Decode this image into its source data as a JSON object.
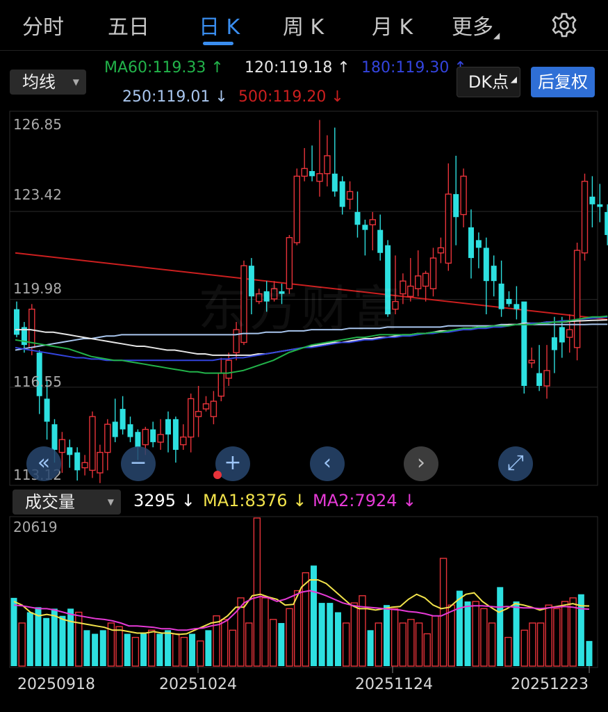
{
  "tabs": [
    {
      "label": "分时",
      "active": false
    },
    {
      "label": "五日",
      "active": false
    },
    {
      "label": "日 K",
      "active": true
    },
    {
      "label": "周 K",
      "active": false
    },
    {
      "label": "月 K",
      "active": false
    },
    {
      "label": "更多",
      "active": false
    }
  ],
  "more_caret": "◢",
  "settings_icon": "gear-icon",
  "indicator_select": {
    "label": "均线",
    "caret": "▼"
  },
  "ma_values": {
    "ma60": "MA60:119.33 ↑",
    "ma120": "120:119.18 ↑",
    "ma180": "180:119.30 ↑",
    "ma250": "250:119.01 ↓",
    "ma500": "500:119.20 ↓"
  },
  "dk_button": {
    "label": "DK点",
    "caret": "◢"
  },
  "adjust_button": "后复权",
  "watermark": "东方财富",
  "controls": {
    "back": "«",
    "zoom_out": "−",
    "zoom_in": "+",
    "prev": "‹",
    "next": "›",
    "fullscreen": "⤢"
  },
  "volume": {
    "select_label": "成交量",
    "caret": "▼",
    "current": "3295 ↓",
    "ma1": "MA1:8376 ↓",
    "ma2": "MA2:7924 ↓",
    "max_label": "20619"
  },
  "dates": [
    "20250918",
    "20251024",
    "20251124",
    "20251223"
  ],
  "colors": {
    "up": "#e8333a",
    "down": "#2de0e0",
    "ma60": "#22b34a",
    "ma120": "#e6e6e6",
    "ma180": "#3344dd",
    "ma250": "#a9c6ee",
    "ma500": "#cc1f1f",
    "vma1": "#f2e34b",
    "vma2": "#e63ad6",
    "accent": "#3a8ef0"
  },
  "chart_data": {
    "type": "candlestick",
    "price_ticks": [
      "126.85",
      "123.42",
      "119.98",
      "116.55",
      "113.12"
    ],
    "ylim": [
      113.12,
      126.85
    ],
    "candles": [
      [
        119.6,
        118.6,
        119.9,
        118.5
      ],
      [
        118.9,
        118.2,
        119.1,
        117.9
      ],
      [
        118.1,
        119.6,
        119.8,
        117.8
      ],
      [
        117.9,
        116.2,
        118.0,
        115.5
      ],
      [
        116.1,
        115.2,
        116.8,
        114.5
      ],
      [
        115.1,
        114.1,
        115.3,
        113.6
      ],
      [
        114.0,
        114.5,
        114.8,
        113.2
      ],
      [
        114.2,
        113.9,
        114.5,
        113.4
      ],
      [
        114.0,
        113.3,
        114.2,
        112.9
      ],
      [
        113.4,
        113.6,
        113.9,
        113.1
      ],
      [
        113.3,
        115.4,
        115.6,
        113.0
      ],
      [
        113.2,
        114.0,
        114.3,
        112.8
      ],
      [
        114.0,
        115.1,
        115.3,
        113.3
      ],
      [
        115.2,
        114.6,
        116.1,
        114.4
      ],
      [
        115.7,
        114.9,
        116.2,
        114.7
      ],
      [
        115.1,
        114.6,
        115.4,
        114.4
      ],
      [
        114.8,
        114.2,
        114.9,
        113.7
      ],
      [
        114.3,
        114.9,
        115.0,
        113.9
      ],
      [
        114.9,
        114.4,
        115.2,
        114.2
      ],
      [
        114.4,
        114.7,
        115.3,
        114.1
      ],
      [
        115.3,
        114.7,
        115.6,
        114.0
      ],
      [
        115.3,
        114.1,
        115.4,
        113.6
      ],
      [
        114.3,
        114.6,
        115.1,
        114.1
      ],
      [
        114.6,
        116.1,
        116.3,
        114.0
      ],
      [
        115.4,
        115.6,
        116.6,
        114.6
      ],
      [
        115.7,
        115.9,
        116.2,
        115.6
      ],
      [
        115.4,
        116.0,
        116.4,
        115.1
      ],
      [
        116.2,
        117.1,
        117.7,
        116.0
      ],
      [
        116.9,
        117.6,
        117.9,
        116.6
      ],
      [
        117.9,
        118.8,
        119.1,
        117.6
      ],
      [
        118.3,
        121.3,
        121.5,
        118.2
      ],
      [
        121.3,
        120.1,
        121.6,
        119.4
      ],
      [
        119.9,
        120.2,
        120.4,
        119.8
      ],
      [
        120.3,
        119.9,
        120.7,
        119.5
      ],
      [
        120.0,
        120.4,
        120.7,
        119.9
      ],
      [
        120.3,
        120.2,
        120.6,
        119.8
      ],
      [
        120.4,
        122.4,
        122.5,
        120.2
      ],
      [
        122.2,
        124.8,
        125.1,
        122.1
      ],
      [
        124.8,
        125.1,
        125.9,
        124.6
      ],
      [
        125.0,
        124.8,
        126.0,
        124.6
      ],
      [
        124.6,
        124.9,
        127.0,
        124.0
      ],
      [
        124.9,
        125.6,
        126.4,
        124.4
      ],
      [
        124.9,
        124.2,
        126.7,
        124.0
      ],
      [
        124.6,
        123.6,
        124.8,
        123.3
      ],
      [
        123.9,
        124.2,
        124.6,
        123.5
      ],
      [
        123.4,
        122.9,
        124.2,
        122.4
      ],
      [
        122.9,
        122.7,
        123.1,
        121.7
      ],
      [
        122.9,
        123.1,
        123.4,
        121.9
      ],
      [
        122.7,
        121.8,
        123.3,
        121.5
      ],
      [
        122.1,
        119.4,
        122.3,
        119.3
      ],
      [
        119.6,
        119.9,
        121.7,
        119.4
      ],
      [
        120.2,
        120.7,
        121.0,
        119.8
      ],
      [
        120.1,
        120.5,
        121.6,
        119.9
      ],
      [
        120.4,
        120.9,
        121.9,
        120.1
      ],
      [
        120.5,
        121.0,
        121.1,
        119.9
      ],
      [
        120.4,
        121.6,
        122.0,
        120.1
      ],
      [
        121.8,
        122.0,
        122.4,
        121.4
      ],
      [
        121.4,
        124.1,
        125.3,
        121.1
      ],
      [
        124.1,
        123.2,
        125.6,
        122.1
      ],
      [
        123.3,
        124.8,
        125.1,
        122.8
      ],
      [
        122.8,
        121.6,
        123.5,
        120.8
      ],
      [
        122.3,
        122.0,
        122.6,
        121.2
      ],
      [
        122.0,
        120.7,
        122.4,
        119.4
      ],
      [
        121.3,
        120.7,
        121.7,
        120.1
      ],
      [
        120.6,
        119.6,
        121.5,
        119.3
      ],
      [
        120.0,
        119.8,
        120.3,
        119.7
      ],
      [
        119.8,
        119.6,
        120.5,
        119.2
      ],
      [
        119.9,
        116.6,
        119.8,
        116.3
      ],
      [
        117.5,
        117.6,
        118.1,
        117.3
      ],
      [
        117.1,
        116.6,
        118.2,
        116.4
      ],
      [
        116.6,
        117.2,
        118.2,
        116.1
      ],
      [
        118.5,
        118.0,
        119.3,
        117.1
      ],
      [
        118.9,
        118.3,
        119.3,
        117.7
      ],
      [
        118.5,
        118.8,
        119.4,
        117.9
      ],
      [
        118.1,
        121.9,
        122.2,
        117.6
      ],
      [
        121.8,
        124.6,
        124.9,
        121.5
      ],
      [
        124.0,
        123.7,
        124.8,
        122.8
      ],
      [
        123.7,
        123.6,
        124.5,
        123.0
      ],
      [
        123.4,
        122.5,
        123.7,
        122.1
      ]
    ],
    "ma60": [
      118.4,
      118.35,
      118.3,
      118.25,
      118.2,
      118.15,
      118.1,
      118.05,
      117.95,
      117.85,
      117.75,
      117.7,
      117.65,
      117.6,
      117.6,
      117.55,
      117.5,
      117.45,
      117.4,
      117.35,
      117.3,
      117.25,
      117.2,
      117.15,
      117.15,
      117.1,
      117.1,
      117.1,
      117.1,
      117.15,
      117.2,
      117.3,
      117.4,
      117.5,
      117.6,
      117.75,
      117.9,
      118.0,
      118.1,
      118.2,
      118.25,
      118.3,
      118.35,
      118.4,
      118.45,
      118.5,
      118.5,
      118.55,
      118.6,
      118.6,
      118.6,
      118.6,
      118.6,
      118.65,
      118.65,
      118.7,
      118.7,
      118.75,
      118.8,
      118.85,
      118.85,
      118.9,
      118.9,
      118.95,
      118.95,
      118.95,
      119.0,
      119.0,
      119.0,
      119.05,
      119.05,
      119.1,
      119.1,
      119.15,
      119.2,
      119.25,
      119.3,
      119.3,
      119.33
    ],
    "ma120": [
      118.8,
      118.8,
      118.8,
      118.75,
      118.7,
      118.7,
      118.65,
      118.6,
      118.55,
      118.5,
      118.45,
      118.4,
      118.35,
      118.3,
      118.25,
      118.2,
      118.15,
      118.15,
      118.1,
      118.05,
      118.0,
      118.0,
      117.95,
      117.9,
      117.85,
      117.85,
      117.8,
      117.8,
      117.8,
      117.8,
      117.8,
      117.8,
      117.85,
      117.85,
      117.9,
      117.95,
      118.0,
      118.05,
      118.1,
      118.15,
      118.2,
      118.25,
      118.3,
      118.3,
      118.35,
      118.4,
      118.45,
      118.45,
      118.5,
      118.5,
      118.55,
      118.6,
      118.6,
      118.65,
      118.65,
      118.7,
      118.75,
      118.75,
      118.8,
      118.85,
      118.85,
      118.9,
      118.9,
      118.95,
      118.95,
      119.0,
      119.0,
      119.05,
      119.05,
      119.05,
      119.1,
      119.1,
      119.1,
      119.12,
      119.14,
      119.15,
      119.16,
      119.17,
      119.18
    ],
    "ma180": [
      118.1,
      118.05,
      118.0,
      117.95,
      117.9,
      117.85,
      117.8,
      117.75,
      117.7,
      117.7,
      117.65,
      117.65,
      117.6,
      117.6,
      117.6,
      117.6,
      117.6,
      117.6,
      117.6,
      117.6,
      117.6,
      117.6,
      117.6,
      117.6,
      117.6,
      117.6,
      117.6,
      117.65,
      117.65,
      117.7,
      117.7,
      117.75,
      117.8,
      117.85,
      117.9,
      117.95,
      118.0,
      118.05,
      118.1,
      118.1,
      118.15,
      118.2,
      118.25,
      118.3,
      118.3,
      118.35,
      118.4,
      118.4,
      118.45,
      118.5,
      118.5,
      118.55,
      118.55,
      118.6,
      118.65,
      118.65,
      118.7,
      118.7,
      118.75,
      118.8,
      118.8,
      118.85,
      118.85,
      118.9,
      118.9,
      118.95,
      119.0,
      119.0,
      119.05,
      119.05,
      119.1,
      119.1,
      119.15,
      119.15,
      119.2,
      119.22,
      119.25,
      119.27,
      119.3
    ],
    "ma250": [
      118.0,
      118.05,
      118.1,
      118.15,
      118.2,
      118.25,
      118.3,
      118.35,
      118.4,
      118.45,
      118.45,
      118.5,
      118.55,
      118.55,
      118.6,
      118.6,
      118.6,
      118.6,
      118.6,
      118.6,
      118.6,
      118.6,
      118.6,
      118.6,
      118.6,
      118.6,
      118.6,
      118.6,
      118.6,
      118.6,
      118.65,
      118.65,
      118.65,
      118.7,
      118.7,
      118.7,
      118.75,
      118.75,
      118.75,
      118.8,
      118.8,
      118.8,
      118.8,
      118.8,
      118.85,
      118.85,
      118.85,
      118.85,
      118.85,
      118.9,
      118.9,
      118.9,
      118.9,
      118.9,
      118.9,
      118.9,
      118.9,
      118.95,
      118.95,
      118.95,
      118.95,
      118.95,
      118.95,
      118.95,
      119.0,
      119.0,
      119.0,
      119.0,
      119.0,
      119.0,
      119.0,
      119.0,
      119.0,
      119.0,
      119.0,
      119.0,
      119.01,
      119.01,
      119.01
    ],
    "ma500": {
      "start": 121.8,
      "end": 119.2
    },
    "volume": {
      "ylim": [
        0,
        20619
      ],
      "bars": [
        [
          9500,
          0
        ],
        [
          6000,
          1
        ],
        [
          7500,
          0
        ],
        [
          8200,
          0
        ],
        [
          6700,
          0
        ],
        [
          8000,
          0
        ],
        [
          7000,
          0
        ],
        [
          8000,
          0
        ],
        [
          7500,
          1
        ],
        [
          5000,
          0
        ],
        [
          4500,
          0
        ],
        [
          5000,
          0
        ],
        [
          6000,
          1
        ],
        [
          5500,
          1
        ],
        [
          4500,
          0
        ],
        [
          4000,
          1
        ],
        [
          4500,
          0
        ],
        [
          5000,
          1
        ],
        [
          4500,
          0
        ],
        [
          5000,
          0
        ],
        [
          4500,
          1
        ],
        [
          4000,
          1
        ],
        [
          4500,
          0
        ],
        [
          3500,
          1
        ],
        [
          5000,
          0
        ],
        [
          7000,
          1
        ],
        [
          6500,
          1
        ],
        [
          5000,
          1
        ],
        [
          9500,
          1
        ],
        [
          6000,
          1
        ],
        [
          20619,
          1
        ],
        [
          9500,
          1
        ],
        [
          6500,
          1
        ],
        [
          6000,
          0
        ],
        [
          8000,
          1
        ],
        [
          10500,
          1
        ],
        [
          13000,
          1
        ],
        [
          14000,
          0
        ],
        [
          8800,
          0
        ],
        [
          8800,
          0
        ],
        [
          7500,
          0
        ],
        [
          6000,
          1
        ],
        [
          8800,
          1
        ],
        [
          9800,
          1
        ],
        [
          5000,
          0
        ],
        [
          6000,
          1
        ],
        [
          8500,
          0
        ],
        [
          8000,
          1
        ],
        [
          6000,
          1
        ],
        [
          6500,
          1
        ],
        [
          6000,
          1
        ],
        [
          4500,
          1
        ],
        [
          7000,
          1
        ],
        [
          15000,
          1
        ],
        [
          8500,
          1
        ],
        [
          10500,
          0
        ],
        [
          9000,
          0
        ],
        [
          9000,
          1
        ],
        [
          8000,
          1
        ],
        [
          6000,
          1
        ],
        [
          11000,
          0
        ],
        [
          4000,
          1
        ],
        [
          9000,
          0
        ],
        [
          5000,
          1
        ],
        [
          6000,
          1
        ],
        [
          6000,
          1
        ],
        [
          8500,
          1
        ],
        [
          8000,
          1
        ],
        [
          9000,
          1
        ],
        [
          9500,
          1
        ],
        [
          10000,
          0
        ],
        [
          3500,
          0
        ]
      ],
      "ma1": [
        9000,
        8500,
        7500,
        7000,
        7200,
        7000,
        6500,
        6200,
        6000,
        5800,
        5600,
        5400,
        5000,
        5000,
        4800,
        4600,
        4600,
        4800,
        4600,
        4600,
        4400,
        4500,
        5000,
        5500,
        6000,
        6200,
        7000,
        8200,
        8200,
        9800,
        10000,
        9600,
        9300,
        8500,
        8600,
        11000,
        12000,
        12000,
        11500,
        10500,
        9500,
        8500,
        8000,
        8000,
        7800,
        8000,
        8200,
        8300,
        9300,
        10000,
        9500,
        8500,
        8000,
        8200,
        9200,
        10000,
        10200,
        9000,
        8200,
        7500,
        8000,
        8700,
        8500,
        8200,
        7800,
        8100,
        8300,
        8500,
        8700,
        8400,
        8376
      ],
      "ma2": [
        8500,
        8400,
        8200,
        8000,
        8000,
        7800,
        7500,
        7200,
        7000,
        6800,
        6600,
        6500,
        6300,
        6000,
        5600,
        5600,
        5500,
        5400,
        5200,
        5200,
        5000,
        5000,
        5200,
        5300,
        5600,
        5800,
        6400,
        7500,
        8800,
        9400,
        9700,
        9500,
        9000,
        9300,
        9800,
        10300,
        10500,
        10200,
        9800,
        9300,
        8800,
        8500,
        8300,
        8200,
        8100,
        8000,
        7900,
        7800,
        7600,
        7500,
        7300,
        7000,
        7000,
        7500,
        8000,
        8300,
        8400,
        8400,
        8300,
        8200,
        8300,
        8200,
        8100,
        8100,
        8000,
        8100,
        8200,
        8300,
        8200,
        8000,
        7924
      ]
    }
  }
}
